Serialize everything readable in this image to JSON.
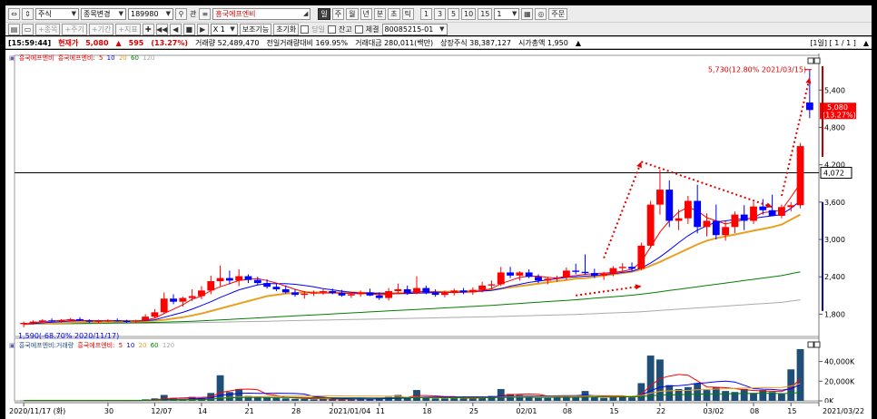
{
  "toolbar": {
    "market": "주식",
    "mode": "종목변경",
    "code": "189980",
    "fn_label": "관",
    "stock_name": "흥국에프엔비",
    "periods": [
      "일",
      "주",
      "월",
      "년",
      "분",
      "초",
      "틱"
    ],
    "intervals": [
      "1",
      "3",
      "5",
      "10",
      "15"
    ],
    "interval_value": "1",
    "order_label": "주문",
    "row2": [
      "종목",
      "주기",
      "기간",
      "지표"
    ],
    "multiplier": "X 1",
    "basic_label": "보조기능",
    "reset_label": "초기화",
    "same_day_label": "당일",
    "balance_label": "잔고",
    "execution_label": "체결",
    "account": "80085215-01"
  },
  "status": {
    "time": "[15:59:44]",
    "label": "현재가",
    "price": "5,080",
    "arrow": "▲",
    "change": "595",
    "change_pct": "(13.27%)",
    "volume": "거래량 52,489,470",
    "prev_ratio": "전일거래량대비 169.95%",
    "amount": "거래대금 280,011(백만)",
    "shares": "상장주식 38,387,127",
    "mcap": "시가총액 1,950",
    "page": "[1일] [ 1 / 1 ]"
  },
  "legend_price": {
    "name": "흥국에프엔비",
    "ma_prefix": "흥국에프엔비:",
    "ma": [
      "5",
      "10",
      "20",
      "60",
      "120"
    ]
  },
  "legend_volume": {
    "name": "흥국에프엔비:거래량",
    "ma_prefix": "흥국에프엔비:",
    "ma": [
      "5",
      "10",
      "20",
      "60",
      "120"
    ]
  },
  "annotations": {
    "high": "5,730(12.80% 2021/03/15)",
    "low": "1,590(-68.70% 2020/11/17)",
    "cur_price": "5,080",
    "cur_pct": "(13.27%)",
    "crosshair_price": "4,072"
  },
  "colors": {
    "up": "#ff0000",
    "down": "#0000ff",
    "ma5": "#ff0000",
    "ma10": "#0000ff",
    "ma20": "#e8a020",
    "ma60": "#008000",
    "ma120": "#aaaaaa",
    "volume": "#1f4e79"
  },
  "chart_data": [
    {
      "type": "candlestick",
      "y_ticks": [
        "5,400",
        "4,800",
        "4,200",
        "3,600",
        "3,000",
        "2,400",
        "1,800"
      ],
      "ylim": [
        1500,
        5900
      ],
      "x_ticks": [
        "2020/11/17 (화)",
        "30",
        "12/07",
        "14",
        "21",
        "28",
        "2021/01/04",
        "11",
        "18",
        "25",
        "02/01",
        "08",
        "15",
        "22",
        "03/02",
        "08",
        "15",
        "2021/03/22"
      ],
      "candles": [
        {
          "o": 1640,
          "h": 1680,
          "l": 1590,
          "c": 1660
        },
        {
          "o": 1660,
          "h": 1700,
          "l": 1630,
          "c": 1680
        },
        {
          "o": 1680,
          "h": 1720,
          "l": 1660,
          "c": 1700
        },
        {
          "o": 1700,
          "h": 1730,
          "l": 1670,
          "c": 1690
        },
        {
          "o": 1690,
          "h": 1720,
          "l": 1660,
          "c": 1700
        },
        {
          "o": 1700,
          "h": 1740,
          "l": 1680,
          "c": 1720
        },
        {
          "o": 1720,
          "h": 1750,
          "l": 1690,
          "c": 1700
        },
        {
          "o": 1700,
          "h": 1720,
          "l": 1660,
          "c": 1680
        },
        {
          "o": 1680,
          "h": 1710,
          "l": 1650,
          "c": 1690
        },
        {
          "o": 1690,
          "h": 1720,
          "l": 1670,
          "c": 1700
        },
        {
          "o": 1700,
          "h": 1730,
          "l": 1680,
          "c": 1690
        },
        {
          "o": 1690,
          "h": 1710,
          "l": 1660,
          "c": 1680
        },
        {
          "o": 1680,
          "h": 1710,
          "l": 1660,
          "c": 1700
        },
        {
          "o": 1700,
          "h": 1800,
          "l": 1690,
          "c": 1760
        },
        {
          "o": 1760,
          "h": 1880,
          "l": 1740,
          "c": 1830
        },
        {
          "o": 1830,
          "h": 2150,
          "l": 1800,
          "c": 2050
        },
        {
          "o": 2050,
          "h": 2120,
          "l": 1960,
          "c": 2000
        },
        {
          "o": 2000,
          "h": 2080,
          "l": 1920,
          "c": 2060
        },
        {
          "o": 2060,
          "h": 2200,
          "l": 2010,
          "c": 2090
        },
        {
          "o": 2090,
          "h": 2250,
          "l": 2040,
          "c": 2180
        },
        {
          "o": 2180,
          "h": 2420,
          "l": 2120,
          "c": 2330
        },
        {
          "o": 2330,
          "h": 2580,
          "l": 2250,
          "c": 2380
        },
        {
          "o": 2380,
          "h": 2500,
          "l": 2280,
          "c": 2340
        },
        {
          "o": 2340,
          "h": 2520,
          "l": 2250,
          "c": 2410
        },
        {
          "o": 2410,
          "h": 2440,
          "l": 2300,
          "c": 2350
        },
        {
          "o": 2350,
          "h": 2400,
          "l": 2260,
          "c": 2300
        },
        {
          "o": 2300,
          "h": 2360,
          "l": 2210,
          "c": 2240
        },
        {
          "o": 2240,
          "h": 2300,
          "l": 2170,
          "c": 2200
        },
        {
          "o": 2200,
          "h": 2260,
          "l": 2130,
          "c": 2150
        },
        {
          "o": 2150,
          "h": 2200,
          "l": 2080,
          "c": 2110
        },
        {
          "o": 2110,
          "h": 2170,
          "l": 2050,
          "c": 2130
        },
        {
          "o": 2130,
          "h": 2180,
          "l": 2090,
          "c": 2150
        },
        {
          "o": 2150,
          "h": 2200,
          "l": 2110,
          "c": 2170
        },
        {
          "o": 2170,
          "h": 2210,
          "l": 2120,
          "c": 2140
        },
        {
          "o": 2140,
          "h": 2190,
          "l": 2080,
          "c": 2100
        },
        {
          "o": 2100,
          "h": 2160,
          "l": 2060,
          "c": 2120
        },
        {
          "o": 2120,
          "h": 2180,
          "l": 2080,
          "c": 2150
        },
        {
          "o": 2150,
          "h": 2210,
          "l": 2090,
          "c": 2100
        },
        {
          "o": 2100,
          "h": 2150,
          "l": 2030,
          "c": 2060
        },
        {
          "o": 2060,
          "h": 2220,
          "l": 2020,
          "c": 2170
        },
        {
          "o": 2170,
          "h": 2290,
          "l": 2120,
          "c": 2200
        },
        {
          "o": 2200,
          "h": 2260,
          "l": 2110,
          "c": 2140
        },
        {
          "o": 2140,
          "h": 2410,
          "l": 2120,
          "c": 2220
        },
        {
          "o": 2220,
          "h": 2260,
          "l": 2120,
          "c": 2150
        },
        {
          "o": 2150,
          "h": 2200,
          "l": 2080,
          "c": 2110
        },
        {
          "o": 2110,
          "h": 2180,
          "l": 2070,
          "c": 2140
        },
        {
          "o": 2140,
          "h": 2210,
          "l": 2100,
          "c": 2180
        },
        {
          "o": 2180,
          "h": 2220,
          "l": 2120,
          "c": 2150
        },
        {
          "o": 2150,
          "h": 2230,
          "l": 2110,
          "c": 2190
        },
        {
          "o": 2190,
          "h": 2320,
          "l": 2150,
          "c": 2260
        },
        {
          "o": 2260,
          "h": 2340,
          "l": 2200,
          "c": 2280
        },
        {
          "o": 2280,
          "h": 2560,
          "l": 2250,
          "c": 2470
        },
        {
          "o": 2470,
          "h": 2560,
          "l": 2380,
          "c": 2420
        },
        {
          "o": 2420,
          "h": 2490,
          "l": 2340,
          "c": 2470
        },
        {
          "o": 2470,
          "h": 2520,
          "l": 2380,
          "c": 2400
        },
        {
          "o": 2400,
          "h": 2440,
          "l": 2300,
          "c": 2340
        },
        {
          "o": 2340,
          "h": 2400,
          "l": 2280,
          "c": 2370
        },
        {
          "o": 2370,
          "h": 2420,
          "l": 2320,
          "c": 2390
        },
        {
          "o": 2390,
          "h": 2550,
          "l": 2350,
          "c": 2500
        },
        {
          "o": 2500,
          "h": 2610,
          "l": 2440,
          "c": 2480
        },
        {
          "o": 2480,
          "h": 2760,
          "l": 2430,
          "c": 2460
        },
        {
          "o": 2460,
          "h": 2530,
          "l": 2380,
          "c": 2420
        },
        {
          "o": 2420,
          "h": 2480,
          "l": 2350,
          "c": 2450
        },
        {
          "o": 2450,
          "h": 2570,
          "l": 2410,
          "c": 2540
        },
        {
          "o": 2540,
          "h": 2620,
          "l": 2470,
          "c": 2560
        },
        {
          "o": 2560,
          "h": 2630,
          "l": 2490,
          "c": 2530
        },
        {
          "o": 2530,
          "h": 2950,
          "l": 2510,
          "c": 2900
        },
        {
          "o": 2900,
          "h": 3620,
          "l": 2860,
          "c": 3560
        },
        {
          "o": 3560,
          "h": 4120,
          "l": 3400,
          "c": 3800
        },
        {
          "o": 3800,
          "h": 3950,
          "l": 3200,
          "c": 3300
        },
        {
          "o": 3300,
          "h": 3480,
          "l": 3150,
          "c": 3340
        },
        {
          "o": 3340,
          "h": 3700,
          "l": 3250,
          "c": 3620
        },
        {
          "o": 3620,
          "h": 3880,
          "l": 3100,
          "c": 3200
        },
        {
          "o": 3200,
          "h": 3420,
          "l": 3050,
          "c": 3300
        },
        {
          "o": 3300,
          "h": 3560,
          "l": 3000,
          "c": 3070
        },
        {
          "o": 3070,
          "h": 3300,
          "l": 2980,
          "c": 3200
        },
        {
          "o": 3200,
          "h": 3450,
          "l": 3100,
          "c": 3400
        },
        {
          "o": 3400,
          "h": 3550,
          "l": 3150,
          "c": 3300
        },
        {
          "o": 3300,
          "h": 3600,
          "l": 3250,
          "c": 3530
        },
        {
          "o": 3530,
          "h": 3650,
          "l": 3400,
          "c": 3470
        },
        {
          "o": 3470,
          "h": 3720,
          "l": 3420,
          "c": 3380
        },
        {
          "o": 3380,
          "h": 3560,
          "l": 3340,
          "c": 3520
        },
        {
          "o": 3520,
          "h": 3600,
          "l": 3450,
          "c": 3550
        },
        {
          "o": 3550,
          "h": 4550,
          "l": 3500,
          "c": 4500
        },
        {
          "o": 5200,
          "h": 5730,
          "l": 4950,
          "c": 5080
        }
      ],
      "ma": {
        "ma5": [
          1640,
          1660,
          1680,
          1690,
          1700,
          1710,
          1700,
          1695,
          1690,
          1692,
          1693,
          1688,
          1690,
          1705,
          1735,
          1810,
          1880,
          1950,
          2040,
          2090,
          2180,
          2240,
          2290,
          2340,
          2360,
          2370,
          2340,
          2300,
          2250,
          2200,
          2160,
          2140,
          2140,
          2140,
          2140,
          2130,
          2130,
          2130,
          2110,
          2120,
          2130,
          2140,
          2170,
          2160,
          2160,
          2150,
          2150,
          2150,
          2160,
          2180,
          2210,
          2290,
          2340,
          2390,
          2410,
          2410,
          2390,
          2380,
          2410,
          2420,
          2440,
          2450,
          2460,
          2470,
          2490,
          2520,
          2640,
          2880,
          3120,
          3300,
          3440,
          3520,
          3460,
          3350,
          3300,
          3250,
          3280,
          3320,
          3350,
          3430,
          3450,
          3470,
          3680,
          3900
        ],
        "ma10": [
          1640,
          1650,
          1660,
          1670,
          1680,
          1690,
          1695,
          1695,
          1695,
          1695,
          1695,
          1693,
          1690,
          1695,
          1710,
          1750,
          1790,
          1830,
          1880,
          1940,
          2000,
          2070,
          2130,
          2190,
          2230,
          2270,
          2290,
          2290,
          2290,
          2280,
          2260,
          2240,
          2210,
          2190,
          2170,
          2150,
          2140,
          2140,
          2130,
          2130,
          2130,
          2130,
          2140,
          2140,
          2150,
          2150,
          2150,
          2155,
          2160,
          2170,
          2180,
          2210,
          2250,
          2280,
          2310,
          2330,
          2350,
          2370,
          2390,
          2400,
          2410,
          2420,
          2440,
          2450,
          2470,
          2490,
          2540,
          2620,
          2720,
          2830,
          2950,
          3060,
          3150,
          3220,
          3280,
          3300,
          3320,
          3330,
          3340,
          3360,
          3380,
          3400,
          3500,
          3620
        ],
        "ma20": [
          1640,
          1645,
          1650,
          1655,
          1660,
          1665,
          1670,
          1675,
          1680,
          1682,
          1684,
          1686,
          1688,
          1690,
          1695,
          1710,
          1730,
          1750,
          1780,
          1810,
          1850,
          1890,
          1930,
          1970,
          2010,
          2050,
          2090,
          2110,
          2130,
          2140,
          2150,
          2150,
          2150,
          2150,
          2150,
          2150,
          2145,
          2140,
          2140,
          2140,
          2140,
          2140,
          2145,
          2150,
          2155,
          2160,
          2165,
          2170,
          2175,
          2180,
          2190,
          2210,
          2230,
          2250,
          2270,
          2290,
          2310,
          2330,
          2350,
          2370,
          2380,
          2400,
          2420,
          2440,
          2460,
          2480,
          2520,
          2580,
          2640,
          2710,
          2780,
          2850,
          2920,
          2980,
          3020,
          3050,
          3080,
          3110,
          3140,
          3170,
          3200,
          3240,
          3320,
          3400
        ],
        "ma60": [
          1640,
          1642,
          1644,
          1646,
          1648,
          1650,
          1652,
          1654,
          1656,
          1658,
          1660,
          1662,
          1664,
          1666,
          1668,
          1672,
          1676,
          1680,
          1686,
          1692,
          1700,
          1708,
          1716,
          1724,
          1732,
          1740,
          1748,
          1756,
          1764,
          1772,
          1780,
          1788,
          1796,
          1804,
          1812,
          1820,
          1828,
          1836,
          1844,
          1852,
          1860,
          1868,
          1876,
          1884,
          1892,
          1900,
          1908,
          1916,
          1924,
          1932,
          1942,
          1952,
          1962,
          1972,
          1982,
          1992,
          2002,
          2012,
          2022,
          2032,
          2044,
          2056,
          2068,
          2080,
          2092,
          2104,
          2120,
          2140,
          2160,
          2180,
          2200,
          2220,
          2240,
          2260,
          2280,
          2300,
          2320,
          2340,
          2360,
          2380,
          2400,
          2420,
          2450,
          2480
        ],
        "ma120": [
          1640,
          1641,
          1642,
          1643,
          1644,
          1645,
          1646,
          1647,
          1648,
          1649,
          1650,
          1651,
          1652,
          1653,
          1654,
          1656,
          1658,
          1660,
          1663,
          1666,
          1669,
          1672,
          1675,
          1678,
          1681,
          1684,
          1687,
          1690,
          1693,
          1696,
          1699,
          1702,
          1705,
          1708,
          1711,
          1714,
          1717,
          1720,
          1723,
          1726,
          1729,
          1732,
          1735,
          1738,
          1741,
          1744,
          1747,
          1750,
          1753,
          1756,
          1760,
          1764,
          1768,
          1772,
          1776,
          1780,
          1784,
          1788,
          1792,
          1796,
          1802,
          1808,
          1814,
          1820,
          1826,
          1832,
          1840,
          1850,
          1860,
          1870,
          1880,
          1890,
          1900,
          1910,
          1920,
          1930,
          1940,
          1950,
          1960,
          1970,
          1980,
          1990,
          2010,
          2030
        ]
      }
    },
    {
      "type": "bar",
      "y_ticks": [
        "40,000K",
        "20,000K",
        "0K"
      ],
      "ylim": [
        0,
        52500
      ],
      "volume": [
        300,
        400,
        500,
        400,
        300,
        400,
        500,
        300,
        400,
        300,
        300,
        300,
        400,
        1500,
        2500,
        6000,
        3000,
        2000,
        4000,
        3000,
        8000,
        26000,
        9000,
        12000,
        5000,
        4000,
        3500,
        3000,
        2500,
        2000,
        2000,
        1500,
        2000,
        1800,
        1500,
        2000,
        2500,
        2000,
        3000,
        4000,
        6000,
        3000,
        11000,
        3000,
        2500,
        2500,
        3000,
        2500,
        3000,
        4000,
        5000,
        12000,
        7000,
        6000,
        5000,
        3000,
        3000,
        3500,
        5000,
        4000,
        10000,
        4000,
        3000,
        5000,
        4000,
        3500,
        18000,
        46000,
        42000,
        16000,
        12000,
        14000,
        18000,
        11000,
        14000,
        10000,
        9000,
        12000,
        8000,
        11000,
        9000,
        7000,
        32000,
        52500
      ]
    }
  ]
}
